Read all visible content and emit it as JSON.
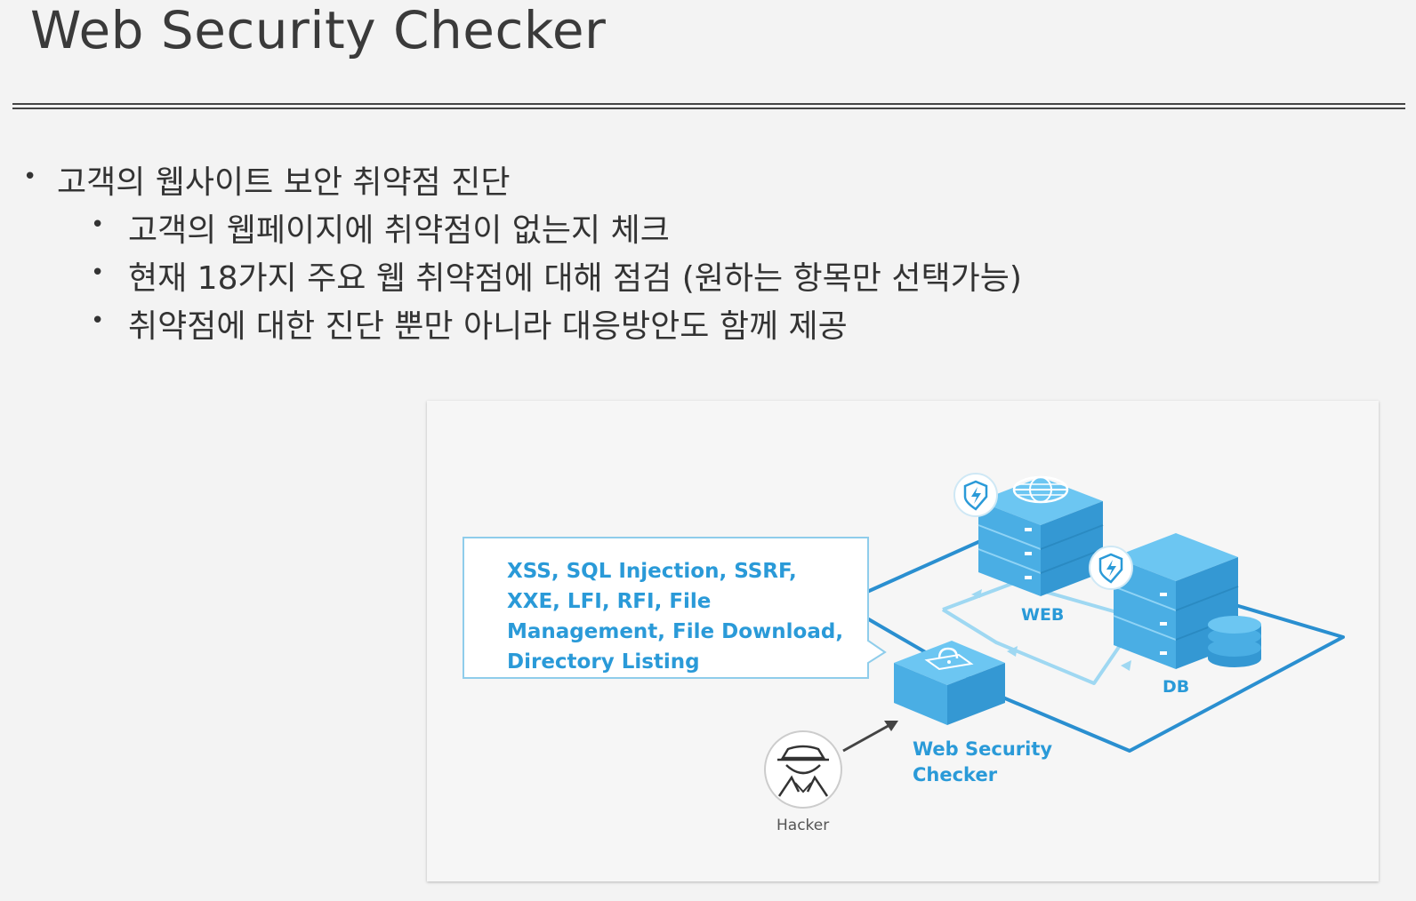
{
  "title": "Web Security Checker",
  "bullets": {
    "main": "고객의 웹사이트 보안 취약점 진단",
    "sub": [
      "고객의 웹페이지에 취약점이 없는지 체크",
      "현재 18가지 주요 웹 취약점에 대해 점검 (원하는 항목만 선택가능)",
      "취약점에 대한 진단 뿐만 아니라 대응방안도 함께 제공"
    ]
  },
  "diagram": {
    "callout": "XSS, SQL Injection, SSRF, XXE, LFI, RFI, File Management, File Download, Directory Listing",
    "web_label": "WEB",
    "db_label": "DB",
    "checker_label": "Web Security Checker",
    "hacker_label": "Hacker",
    "colors": {
      "accent": "#2a9ad8",
      "server_top": "#5fbfef",
      "server_side": "#3aa3dc",
      "line_dark": "#2a8fd0",
      "line_light": "#9fd8f2"
    },
    "icons": [
      "shield-lightning-icon",
      "globe-icon",
      "lock-icon",
      "database-icon",
      "hacker-icon",
      "arrow-icon"
    ]
  }
}
